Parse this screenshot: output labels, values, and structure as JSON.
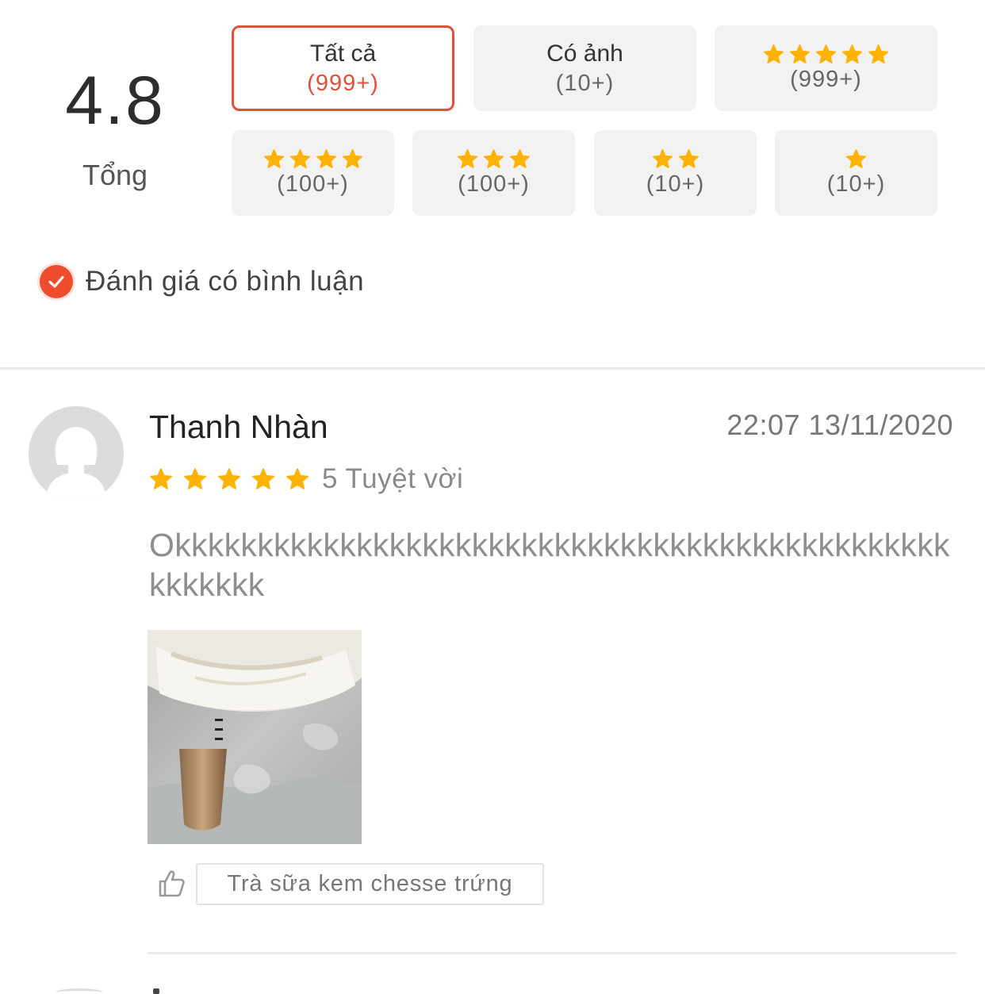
{
  "summary": {
    "average_rating": "4.8",
    "average_label": "Tổng"
  },
  "filters": {
    "row1": [
      {
        "label": "Tất cả",
        "count": "(999+)",
        "stars": 0,
        "active": true
      },
      {
        "label": "Có ảnh",
        "count": "(10+)",
        "stars": 0,
        "active": false
      },
      {
        "label": "",
        "count": "(999+)",
        "stars": 5,
        "active": false
      }
    ],
    "row2": [
      {
        "count": "(100+)",
        "stars": 4
      },
      {
        "count": "(100+)",
        "stars": 3
      },
      {
        "count": "(10+)",
        "stars": 2
      },
      {
        "count": "(10+)",
        "stars": 1
      }
    ],
    "with_comment_label": "Đánh giá có bình luận",
    "with_comment_checked": true
  },
  "review": {
    "reviewer_name": "Thanh Nhàn",
    "timestamp": "22:07 13/11/2020",
    "stars": 5,
    "rating_text": "5 Tuyệt vời",
    "comment": "Okkkkkkkkkkkkkkkkkkkkkkkkkkkkkkkkkkkkkkkkkkkkkkkkkkkkkk",
    "product_tag": "Trà sữa kem chesse trứng"
  },
  "colors": {
    "accent": "#ee4d2d",
    "star": "#ffb300",
    "chip_bg": "#f2f2f2"
  },
  "icons": {
    "star": "star-icon",
    "check": "check-circle-icon",
    "like": "thumbs-up-icon",
    "avatar": "default-avatar-icon"
  }
}
